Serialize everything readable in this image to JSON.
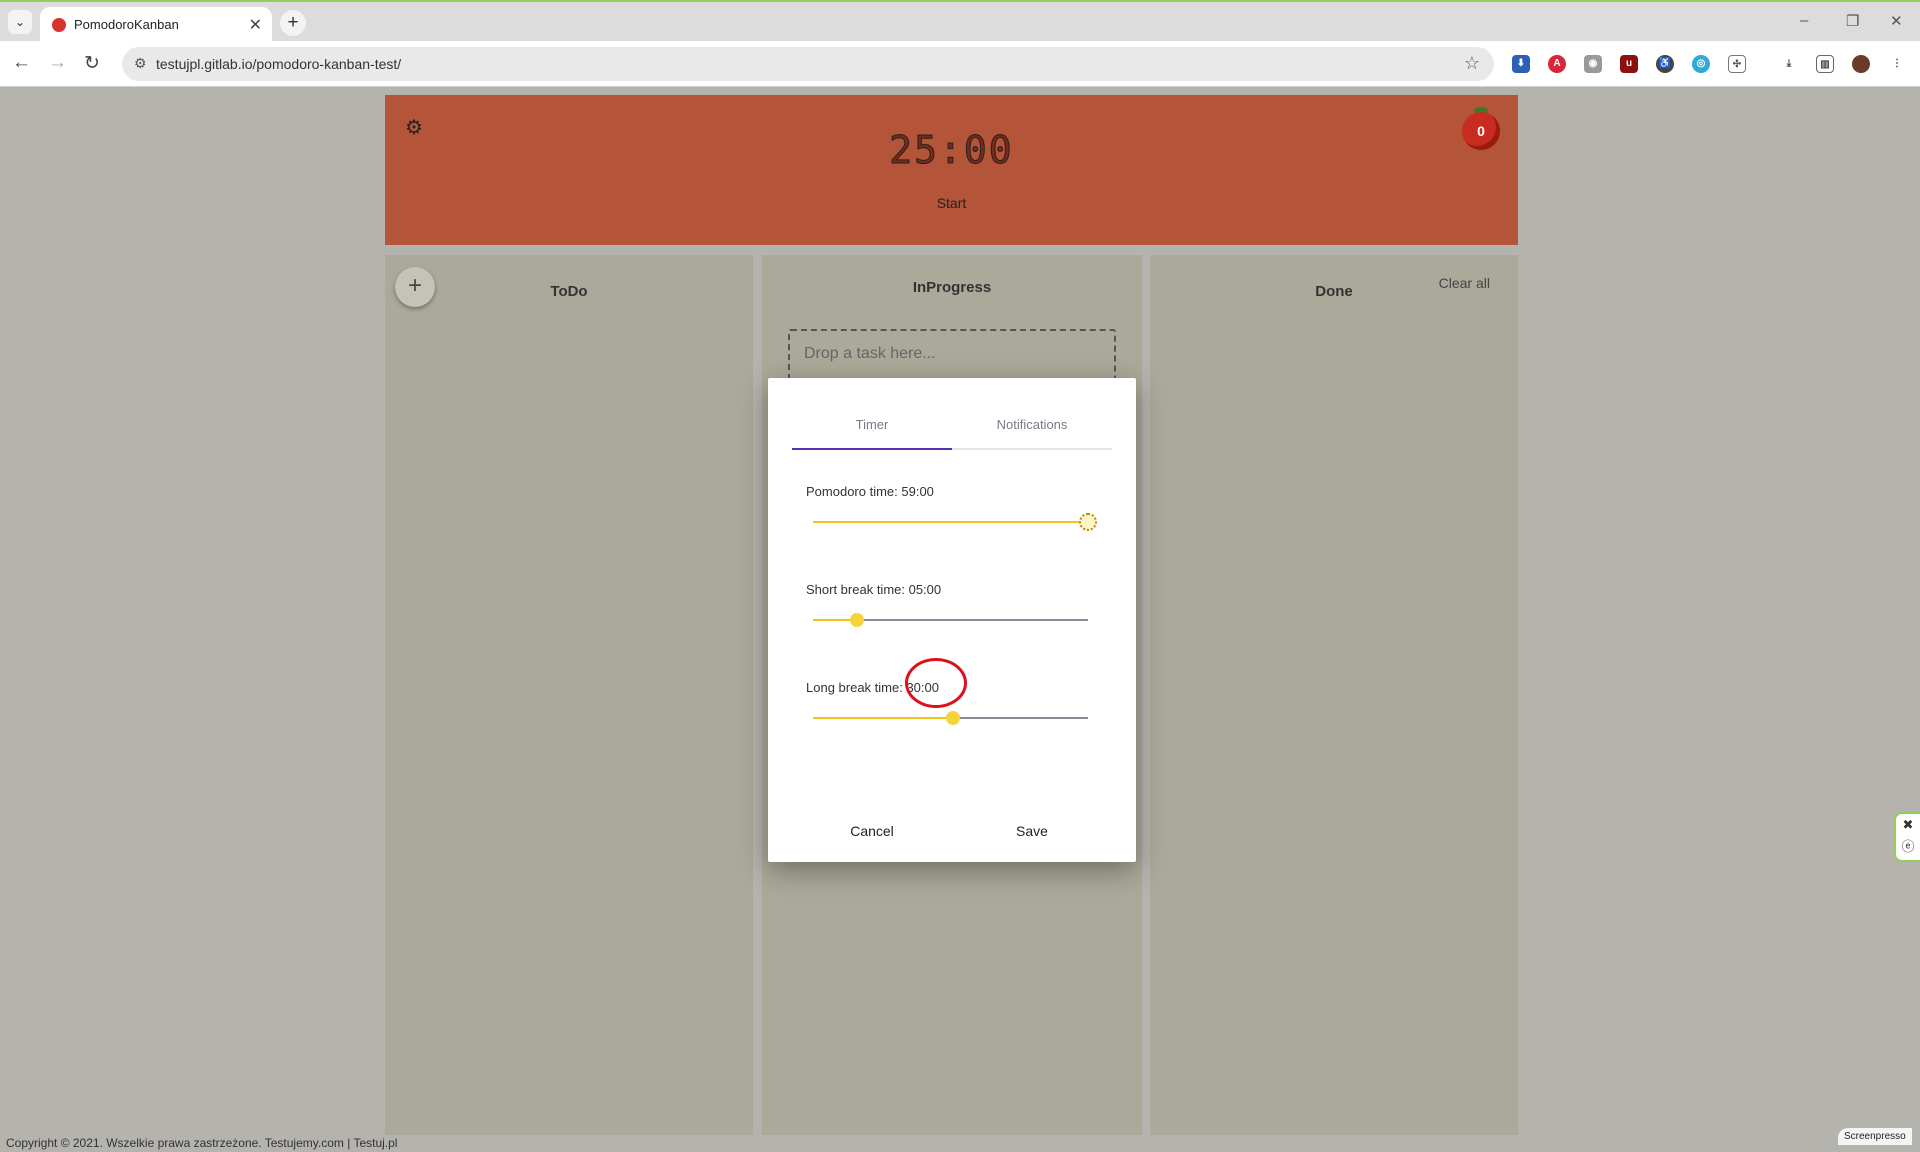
{
  "browser": {
    "tab_title": "PomodoroKanban",
    "url": "testujpl.gitlab.io/pomodoro-kanban-test/",
    "new_tab_label": "+",
    "tab_close_label": "✕"
  },
  "header": {
    "timer": "25:00",
    "start_label": "Start",
    "tomato_count": "0"
  },
  "columns": {
    "todo": {
      "title": "ToDo",
      "add_label": "+"
    },
    "inprogress": {
      "title": "InProgress",
      "drop_placeholder": "Drop a task here..."
    },
    "done": {
      "title": "Done",
      "clear_label": "Clear all"
    }
  },
  "dialog": {
    "tabs": [
      {
        "label": "Timer",
        "active": true
      },
      {
        "label": "Notifications",
        "active": false
      }
    ],
    "settings": [
      {
        "label": "Pomodoro time: 59:00",
        "level": 1.0
      },
      {
        "label": "Short break time: 05:00",
        "level": 0.16
      },
      {
        "label": "Long break time: 30:00",
        "level": 0.51
      }
    ],
    "cancel_label": "Cancel",
    "save_label": "Save"
  },
  "footer": {
    "copyright": "Copyright © 2021. Wszelkie prawa zastrzeżone. Testujemy.com | Testuj.pl"
  },
  "overlay": {
    "brand": "Screenpresso"
  },
  "colors": {
    "header_bg": "#b45438",
    "column_bg": "#aba999",
    "slider_fill": "#f5c21b",
    "tab_accent": "#5a2fb0",
    "annotation": "#e0101a"
  },
  "icons": {
    "settings": "gear-icon",
    "tomato": "tomato-icon",
    "add": "plus-icon"
  }
}
